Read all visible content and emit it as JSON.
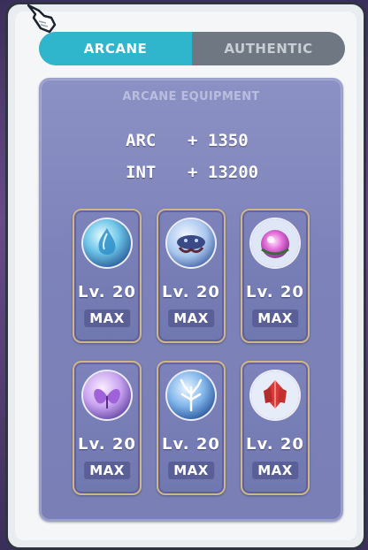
{
  "tabs": [
    {
      "label": "ARCANE",
      "active": true
    },
    {
      "label": "AUTHENTIC",
      "active": false
    }
  ],
  "panel": {
    "title": "ARCANE EQUIPMENT",
    "stats": [
      {
        "name": "ARC",
        "value": "+ 1350"
      },
      {
        "name": "INT",
        "value": "+ 13200"
      }
    ],
    "symbols": [
      {
        "icon": "vanishing-journey-symbol-icon",
        "level": "Lv. 20",
        "status": "MAX"
      },
      {
        "icon": "chu-chu-island-symbol-icon",
        "level": "Lv. 20",
        "status": "MAX"
      },
      {
        "icon": "lachelein-symbol-icon",
        "level": "Lv. 20",
        "status": "MAX"
      },
      {
        "icon": "arcana-symbol-icon",
        "level": "Lv. 20",
        "status": "MAX"
      },
      {
        "icon": "morass-symbol-icon",
        "level": "Lv. 20",
        "status": "MAX"
      },
      {
        "icon": "esfera-symbol-icon",
        "level": "Lv. 20",
        "status": "MAX"
      }
    ]
  },
  "colors": {
    "tab_active": "#2fb6cc",
    "tab_inactive": "#6e7782",
    "panel": "#7d83ba",
    "slot_border": "#cdb68a"
  }
}
